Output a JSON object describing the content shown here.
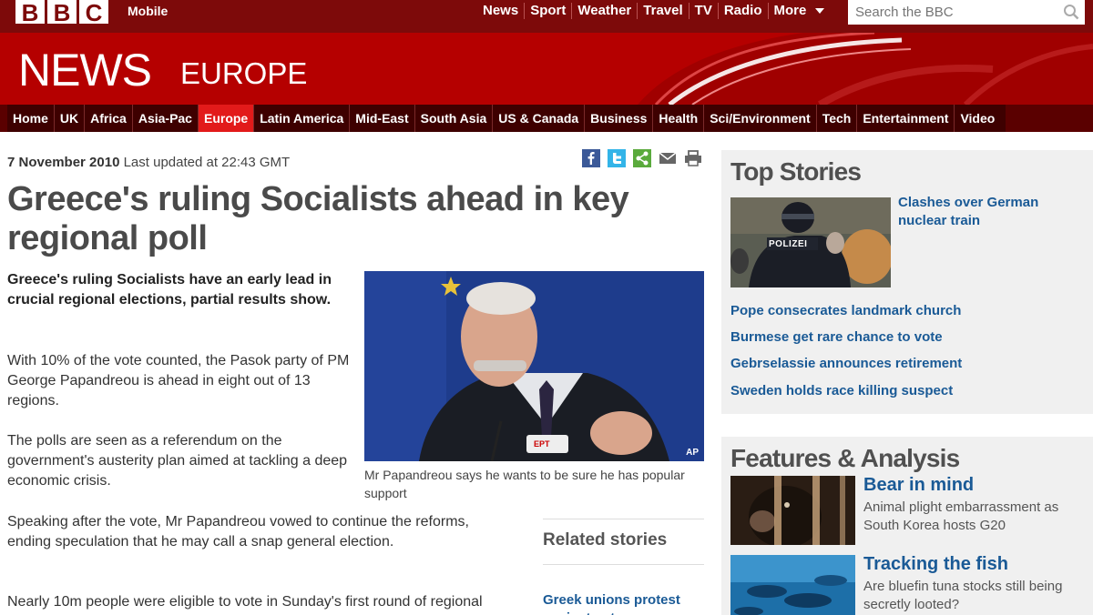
{
  "header": {
    "logo_letters": [
      "B",
      "B",
      "C"
    ],
    "mobile": "Mobile",
    "nav": [
      "News",
      "Sport",
      "Weather",
      "Travel",
      "TV",
      "Radio",
      "More"
    ],
    "search_placeholder": "Search the BBC"
  },
  "banner": {
    "title": "NEWS",
    "section": "EUROPE"
  },
  "section_nav": {
    "items": [
      "Home",
      "UK",
      "Africa",
      "Asia-Pac",
      "Europe",
      "Latin America",
      "Mid-East",
      "South Asia",
      "US & Canada",
      "Business",
      "Health",
      "Sci/Environment",
      "Tech",
      "Entertainment",
      "Video"
    ],
    "active": "Europe"
  },
  "article": {
    "date": "7 November 2010",
    "updated": "Last updated at 22:43 GMT",
    "share_icons": [
      "facebook-icon",
      "twitter-icon",
      "share-icon",
      "email-icon",
      "print-icon"
    ],
    "headline": "Greece's ruling Socialists ahead in key regional poll",
    "intro": "Greece's ruling Socialists have an early lead in crucial regional elections, partial results show.",
    "paragraphs": [
      "With 10% of the vote counted, the Pasok party of PM George Papandreou is ahead in eight out of 13 regions.",
      "The polls are seen as a referendum on the government's austerity plan aimed at tackling a deep economic crisis.",
      "Speaking after the vote, Mr Papandreou vowed to continue the reforms, ending speculation that he may call a snap general election.",
      "Nearly 10m people were eligible to vote in Sunday's first round of regional"
    ],
    "photo_credit": "AP",
    "photo_caption": "Mr Papandreou says he wants to be sure he has popular support",
    "photo_podium_label": "EPT",
    "related_title": "Related stories",
    "related_links": [
      "Greek unions protest against cuts"
    ]
  },
  "sidebar": {
    "top_stories_title": "Top Stories",
    "top_stories_image_label": "POLIZEI",
    "lead_story": "Clashes over German nuclear train",
    "stories": [
      "Pope consecrates landmark church",
      "Burmese get rare chance to vote",
      "Gebrselassie announces retirement",
      "Sweden holds race killing suspect"
    ],
    "features_title": "Features & Analysis",
    "features": [
      {
        "title": "Bear in mind",
        "desc": "Animal plight embarrassment as South Korea hosts G20"
      },
      {
        "title": "Tracking the fish",
        "desc": "Are bluefin tuna stocks still being secretly looted?"
      }
    ]
  },
  "colors": {
    "brand_red": "#bb0000",
    "dark_red": "#7d0a0a",
    "active_tab": "#e21a1a",
    "link_blue": "#1a5a96"
  }
}
